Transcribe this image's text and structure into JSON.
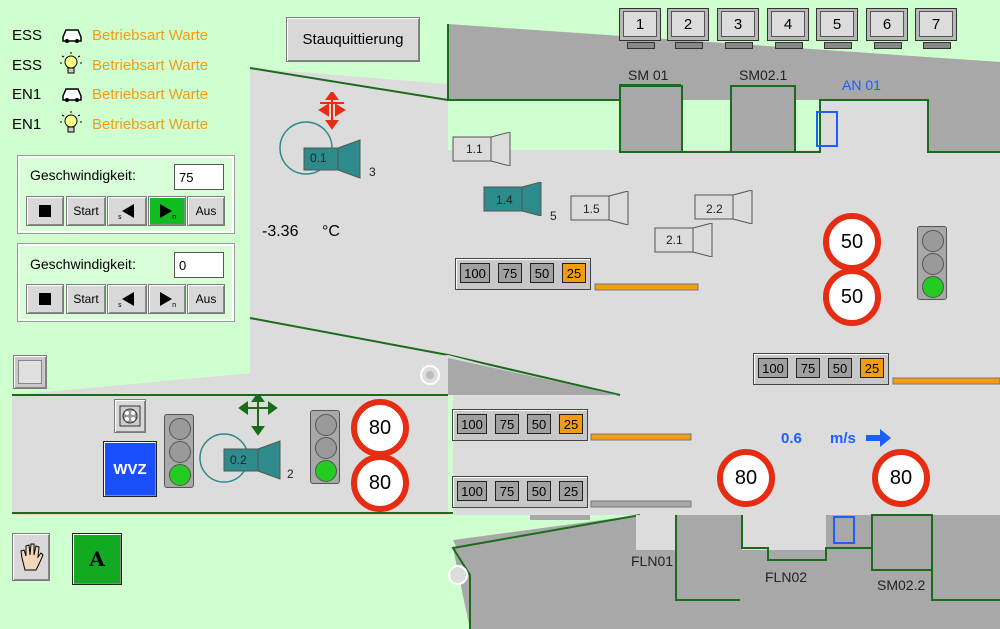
{
  "header": {
    "stauquittierung_label": "Stauquittierung",
    "monitors": [
      "1",
      "2",
      "3",
      "4",
      "5",
      "6",
      "7"
    ]
  },
  "status_lines": [
    {
      "code": "ESS",
      "icon": "car-icon",
      "text": "Betriebsart Warte"
    },
    {
      "code": "ESS",
      "icon": "lightbulb-icon",
      "text": "Betriebsart Warte"
    },
    {
      "code": "EN1",
      "icon": "car-icon",
      "text": "Betriebsart Warte"
    },
    {
      "code": "EN1",
      "icon": "lightbulb-icon",
      "text": "Betriebsart Warte"
    }
  ],
  "speed_panels": [
    {
      "label": "Geschwindigkeit:",
      "value": "75",
      "start": "Start",
      "aus": "Aus",
      "active_forward": true
    },
    {
      "label": "Geschwindigkeit:",
      "value": "0",
      "start": "Start",
      "aus": "Aus",
      "active_forward": false
    }
  ],
  "temperature": {
    "value": "-3.36",
    "unit": "°C"
  },
  "airflow": {
    "value": "0.6",
    "unit": "m/s"
  },
  "cameras": {
    "c01": "0.1",
    "c01_num": "3",
    "c11": "1.1",
    "c14": "1.4",
    "c14_num": "5",
    "c15": "1.5",
    "c22": "2.2",
    "c21": "2.1",
    "c02": "0.2",
    "c02_num": "2"
  },
  "areas": {
    "sm01": "SM 01",
    "sm021": "SM02.1",
    "an01": "AN 01",
    "fln01": "FLN01",
    "fln02": "FLN02",
    "sm022": "SM02.2"
  },
  "speed_limits": {
    "sign1": "50",
    "sign2": "50",
    "sign3": "80",
    "sign4": "80",
    "sign5": "80",
    "sign6": "80"
  },
  "speed_selectors": {
    "options": [
      "100",
      "75",
      "50",
      "25"
    ],
    "sel1_active": "25",
    "sel2_active": "25",
    "sel3_active": "25",
    "sel4_active": "none"
  },
  "wvz_label": "WVZ",
  "mode_button_label": "A",
  "colors": {
    "background": "#cfffcf",
    "tunnel": "#dcdcdc",
    "wall": "#a8a8a8",
    "outline": "#1a6b1a",
    "orange": "#f39c12",
    "red": "#e62c12",
    "camera": "#2e8b8b",
    "blue": "#1a5fff"
  }
}
